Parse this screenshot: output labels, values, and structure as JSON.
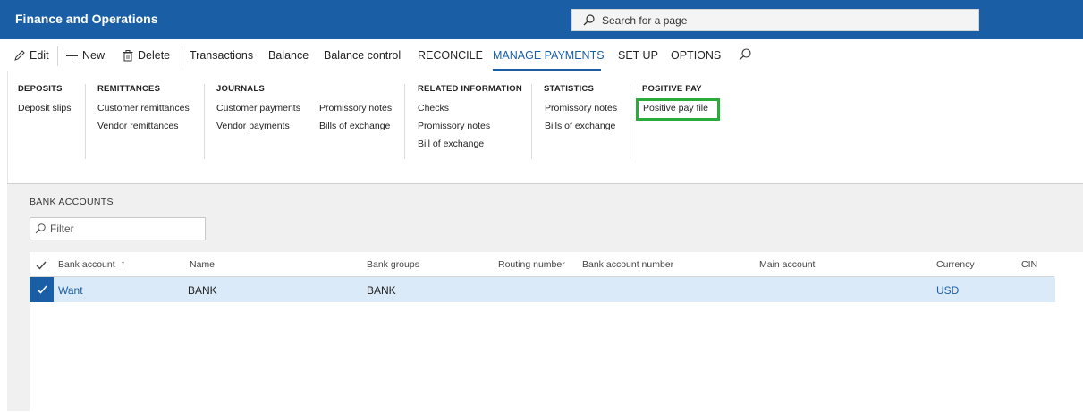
{
  "app": {
    "title": "Finance and Operations"
  },
  "search": {
    "placeholder": "Search for a page"
  },
  "actions": {
    "edit": "Edit",
    "new": "New",
    "delete": "Delete",
    "transactions": "Transactions",
    "balance": "Balance",
    "balance_control": "Balance control",
    "reconcile": "RECONCILE",
    "manage_payments": "MANAGE PAYMENTS",
    "set_up": "SET UP",
    "options": "OPTIONS"
  },
  "ribbon": {
    "deposits": {
      "header": "DEPOSITS",
      "items": [
        "Deposit slips"
      ]
    },
    "remittances": {
      "header": "REMITTANCES",
      "items": [
        "Customer remittances",
        "Vendor remittances"
      ]
    },
    "journals": {
      "header": "JOURNALS",
      "items": [
        "Customer payments",
        "Vendor payments",
        "Promissory notes",
        "Bills of exchange"
      ]
    },
    "related": {
      "header": "RELATED INFORMATION",
      "items": [
        "Checks",
        "Promissory notes",
        "Bill of exchange"
      ]
    },
    "statistics": {
      "header": "STATISTICS",
      "items": [
        "Promissory notes",
        "Bills of exchange"
      ]
    },
    "positive_pay": {
      "header": "POSITIVE PAY",
      "items": [
        "Positive pay file"
      ]
    }
  },
  "bank_accounts": {
    "title": "BANK ACCOUNTS",
    "filter_placeholder": "Filter",
    "columns": [
      "Bank account",
      "Name",
      "Bank groups",
      "Routing number",
      "Bank account number",
      "Main account",
      "Currency",
      "CIN"
    ],
    "sort_indicator": "↑",
    "rows": [
      {
        "bank_account": "Want",
        "name": "BANK",
        "bank_groups": "BANK",
        "routing_number": "",
        "bank_account_number": "",
        "main_account": "",
        "currency": "USD",
        "cin": ""
      }
    ]
  },
  "colors": {
    "brand": "#1a5fa6",
    "highlight": "#2bab3c",
    "selected_row": "#dbeaf8"
  }
}
